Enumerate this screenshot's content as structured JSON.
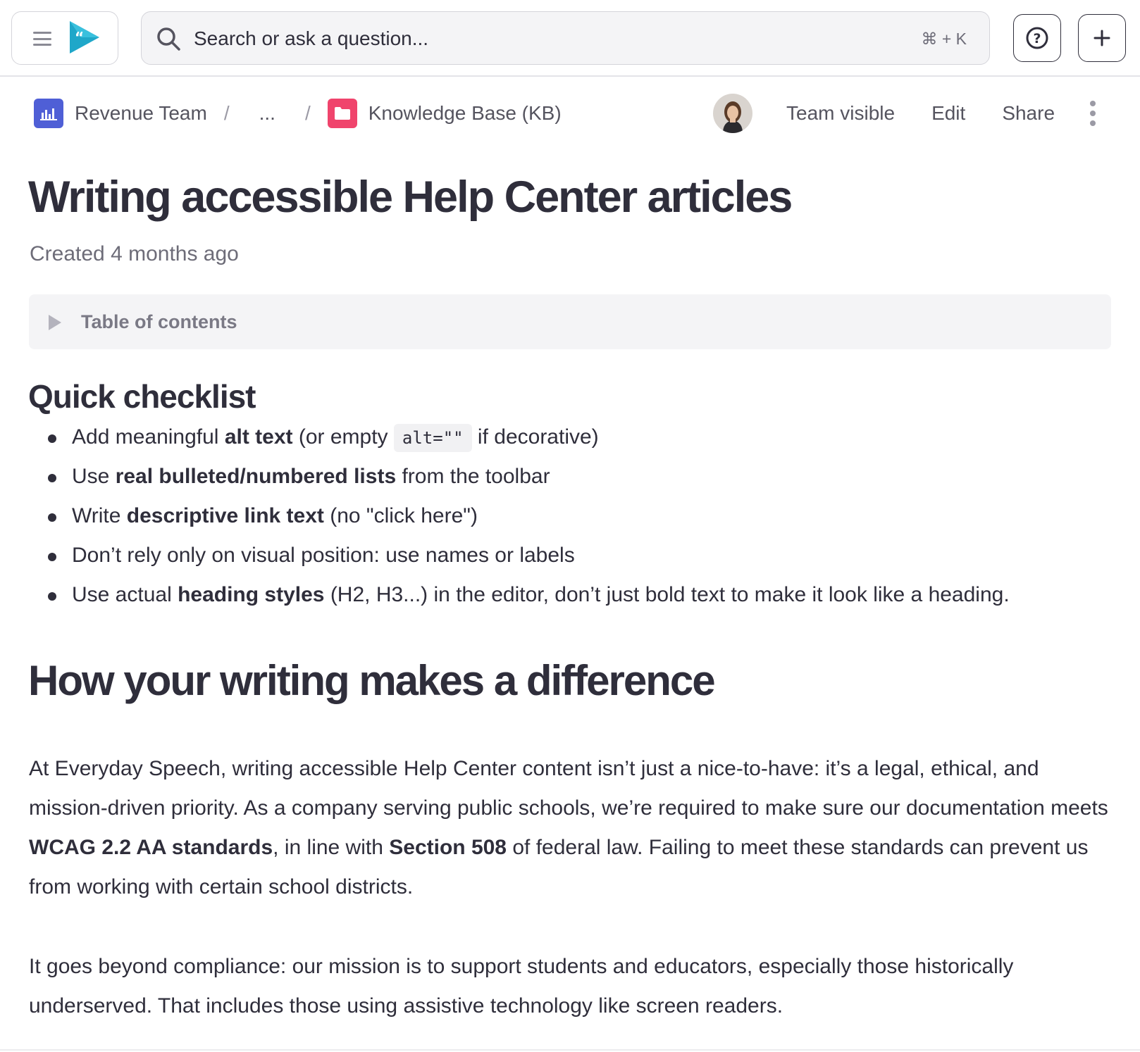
{
  "topbar": {
    "search_placeholder": "Search or ask a question...",
    "search_shortcut": "⌘ + K",
    "help_icon": "question-circle-icon",
    "add_icon": "plus-icon"
  },
  "breadcrumb": {
    "items": [
      {
        "label": "Revenue Team",
        "icon": "bar-chart-icon",
        "color": "#4f5fd6"
      },
      {
        "label": "...",
        "icon": ""
      },
      {
        "label": "Knowledge Base (KB)",
        "icon": "folder-icon",
        "color": "#f0446c"
      }
    ],
    "separator": "/"
  },
  "page_actions": {
    "visibility": "Team visible",
    "edit": "Edit",
    "share": "Share"
  },
  "article": {
    "title": "Writing accessible Help Center articles",
    "created": "Created 4 months ago",
    "toc_label": "Table of contents",
    "checklist_heading": "Quick checklist",
    "checklist": [
      {
        "pre": "Add meaningful ",
        "bold": "alt text",
        "mid": " (or empty ",
        "code": "alt=\"\"",
        "post": " if decorative)"
      },
      {
        "pre": "Use ",
        "bold": "real bulleted/numbered lists",
        "post": " from the toolbar"
      },
      {
        "pre": "Write ",
        "bold": "descriptive link text",
        "post": " (no \"click here\")"
      },
      {
        "pre": "Don’t rely only on visual position: use names or labels"
      },
      {
        "pre": "Use actual ",
        "bold": "heading styles",
        "post": " (H2, H3...) in the editor, don’t just bold text to make it look like a heading."
      }
    ],
    "section_heading": "How your writing makes a difference",
    "para1": {
      "a": "At Everyday Speech, writing accessible Help Center content isn’t just a nice-to-have: it’s a legal, ethical, and mission-driven priority. As a company serving public schools, we’re required to make sure our documentation meets ",
      "b": "WCAG 2.2 AA standards",
      "c": ", in line with ",
      "d": "Section 508",
      "e": " of federal law. Failing to meet these standards can prevent us from working with certain school districts."
    },
    "para2": "It goes beyond compliance: our mission is to support students and educators, especially those historically underserved. That includes those using assistive technology like screen readers."
  },
  "colors": {
    "text": "#2f2e3b",
    "muted": "#6d6c78",
    "logo_teal": "#1fa7c9",
    "toc_bg": "#f4f4f6"
  }
}
